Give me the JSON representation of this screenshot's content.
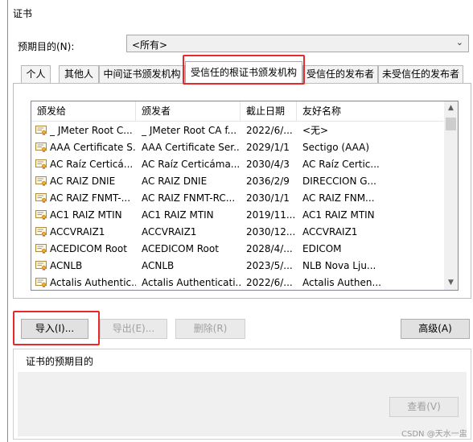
{
  "window": {
    "title": "证书"
  },
  "purpose": {
    "label": "预期目的(N):",
    "value": "<所有>"
  },
  "tabs": [
    {
      "label": "个人"
    },
    {
      "label": "其他人"
    },
    {
      "label": "中间证书颁发机构"
    },
    {
      "label": "受信任的根证书颁发机构"
    },
    {
      "label": "受信任的发布者"
    },
    {
      "label": "未受信任的发布者"
    }
  ],
  "active_tab": 3,
  "list": {
    "columns": [
      "颁发给",
      "颁发者",
      "截止日期",
      "友好名称"
    ],
    "rows": [
      [
        "_ JMeter Root C...",
        "_ JMeter Root CA f...",
        "2022/6/...",
        "<无>"
      ],
      [
        "AAA Certificate S...",
        "AAA Certificate Ser...",
        "2029/1/1",
        "Sectigo (AAA)"
      ],
      [
        "AC Raíz Certicá...",
        "AC Raíz Certicáma...",
        "2030/4/3",
        "AC Raíz Certic..."
      ],
      [
        "AC RAIZ DNIE",
        "AC RAIZ DNIE",
        "2036/2/9",
        "DIRECCION G..."
      ],
      [
        "AC RAIZ FNMT-...",
        "AC RAIZ FNMT-RC...",
        "2030/1/1",
        "AC RAIZ FNM..."
      ],
      [
        "AC1 RAIZ MTIN",
        "AC1 RAIZ MTIN",
        "2019/11...",
        "AC1 RAIZ MTIN"
      ],
      [
        "ACCVRAIZ1",
        "ACCVRAIZ1",
        "2030/12...",
        "ACCVRAIZ1"
      ],
      [
        "ACEDICOM Root",
        "ACEDICOM Root",
        "2028/4/...",
        "EDICOM"
      ],
      [
        "ACNLB",
        "ACNLB",
        "2023/5/...",
        "NLB Nova Lju..."
      ],
      [
        "Actalis Authentic...",
        "Actalis Authenticati...",
        "2022/6/...",
        "Actalis Authen..."
      ]
    ]
  },
  "buttons": {
    "import": "导入(I)...",
    "export": "导出(E)...",
    "remove": "删除(R)",
    "advanced": "高级(A)",
    "view": "查看(V)"
  },
  "purpose_group": {
    "label": "证书的预期目的"
  },
  "watermark": "CSDN @天水一盅",
  "colors": {
    "highlight": "#e8292b",
    "accent": "#6b8cd6"
  },
  "icons": {
    "combo_arrow": "chevron-down-icon",
    "cert": "certificate-icon"
  }
}
